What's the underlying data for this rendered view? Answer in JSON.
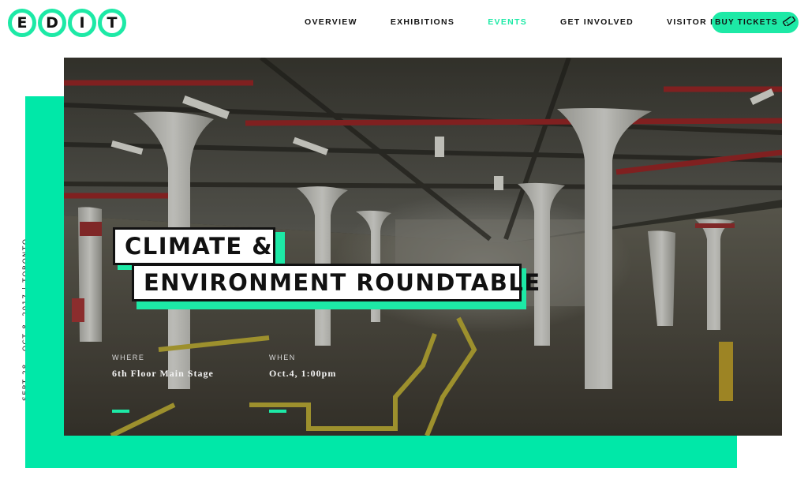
{
  "logo": {
    "letters": [
      "E",
      "D",
      "I",
      "T"
    ]
  },
  "nav": {
    "items": [
      {
        "label": "OVERVIEW",
        "active": false
      },
      {
        "label": "EXHIBITIONS",
        "active": false
      },
      {
        "label": "EVENTS",
        "active": true
      },
      {
        "label": "GET INVOLVED",
        "active": false
      },
      {
        "label": "VISITOR INFO",
        "active": false
      }
    ],
    "buy_tickets": {
      "label": "BUY TICKETS",
      "icon": "ticket-icon"
    }
  },
  "hero": {
    "side_text": "SEPT 28 – OCT 8, 2017 | TORONTO",
    "title_line1": "CLIMATE &",
    "title_line2": "ENVIRONMENT ROUNDTABLE",
    "where_label": "WHERE",
    "where_value": "6th Floor Main Stage",
    "when_label": "WHEN",
    "when_value": "Oct.4, 1:00pm"
  },
  "colors": {
    "accent": "#1de9a6",
    "text": "#111111",
    "white": "#ffffff"
  }
}
